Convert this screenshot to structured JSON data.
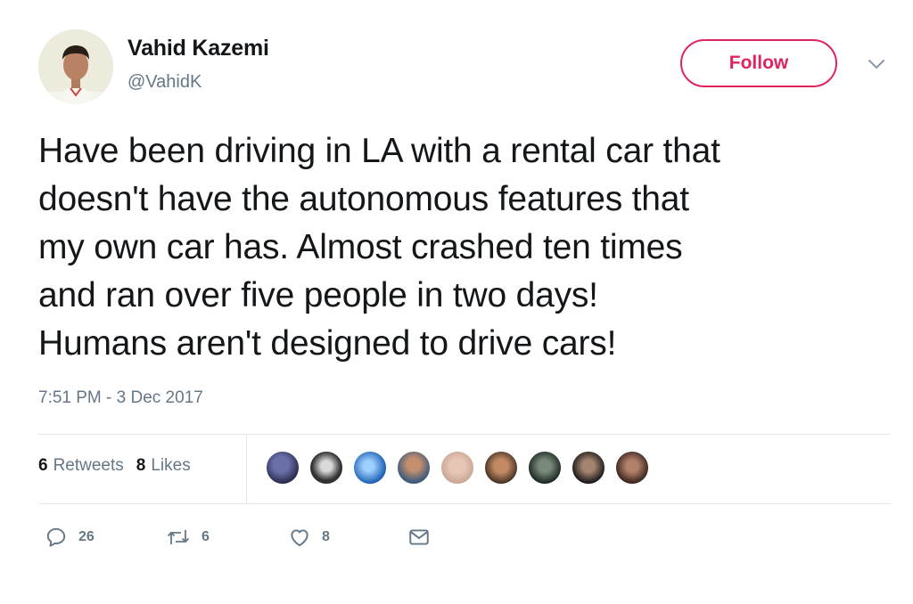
{
  "author": {
    "name": "Vahid Kazemi",
    "handle": "@VahidK"
  },
  "follow_label": "Follow",
  "tweet_lines": [
    "Have been driving in LA with a rental car that",
    "doesn't have the autonomous features that",
    "my own car has. Almost crashed ten times",
    "and ran over five people in two days!",
    "Humans aren't designed to drive cars!"
  ],
  "timestamp": "7:51 PM - 3 Dec 2017",
  "stats": {
    "retweets_count": "6",
    "retweets_label": "Retweets",
    "likes_count": "8",
    "likes_label": "Likes"
  },
  "actions": {
    "reply_count": "26",
    "retweet_count": "6",
    "like_count": "8"
  },
  "colors": {
    "accent": "#e0245e",
    "secondary_text": "#657786",
    "primary_text": "#14171a"
  },
  "icons": [
    "chevron-down-icon",
    "reply-icon",
    "retweet-icon",
    "heart-icon",
    "envelope-icon"
  ]
}
